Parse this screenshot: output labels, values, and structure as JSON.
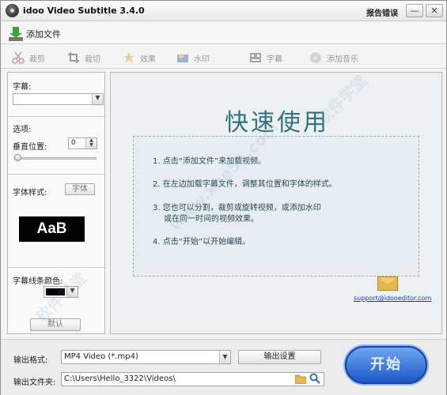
{
  "window": {
    "title": "idoo Video Subtitle 3.4.0",
    "report_link": "报告错误",
    "minimize": "—",
    "close": "✕"
  },
  "menu": {
    "add_file": "添加文件"
  },
  "toolbar": [
    {
      "label": "裁剪",
      "icon": "scissors-icon"
    },
    {
      "label": "裁切",
      "icon": "crop-icon"
    },
    {
      "label": "效果",
      "icon": "effects-icon"
    },
    {
      "label": "水印",
      "icon": "watermark-icon"
    },
    {
      "label": "字幕",
      "icon": "subtitle-icon"
    },
    {
      "label": "添加音乐",
      "icon": "music-icon"
    }
  ],
  "left_panel": {
    "subtitle_label": "字幕:",
    "subtitle_value": "",
    "options_label": "选项:",
    "vertical_position_label": "垂直位置:",
    "vertical_position_value": "0",
    "font_style_label": "字体样式:",
    "font_button": "字体",
    "preview_text": "AaB",
    "outline_color_label": "字幕线条颜色:",
    "default_button": "默认"
  },
  "main": {
    "quickstart_title": "快速使用",
    "steps": [
      "1. 点击“添加文件”来加载视频。",
      "2. 在左边加载字幕文件，调整其位置和字体的样式。",
      "3. 您也可以分割，裁剪或旋转视频，或添加水印",
      "或在同一时间的视频效果。",
      "4. 点击“开始”以开始编辑。"
    ],
    "support_email": "support@idooeditor.com"
  },
  "bottom": {
    "output_format_label": "输出格式:",
    "output_format_value": "MP4 Video (*.mp4)",
    "output_settings_button": "输出设置",
    "output_folder_label": "输出文件夹:",
    "output_folder_value": "C:\\Users\\Hello_3322\\Videos\\",
    "start_button": "开始"
  },
  "watermark": [
    "软件学堂",
    "www.xue51.com"
  ]
}
